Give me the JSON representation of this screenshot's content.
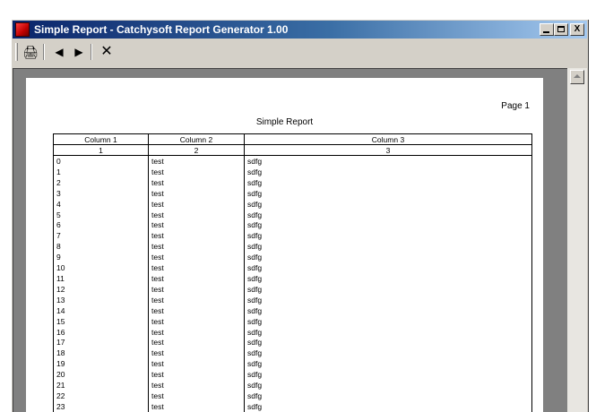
{
  "window": {
    "title": "Simple Report - Catchysoft Report Generator 1.00",
    "minimize_glyph": "_",
    "maximize_glyph": "□",
    "close_glyph": "X"
  },
  "toolbar": {
    "print_glyph": "🖨",
    "prev_glyph": "◀",
    "next_glyph": "▶",
    "close_glyph": "✕"
  },
  "report": {
    "page_label": "Page 1",
    "title": "Simple Report",
    "headers": [
      "Column 1",
      "Column 2",
      "Column 3"
    ],
    "subheaders": [
      "1",
      "2",
      "3"
    ],
    "rows": [
      [
        "0",
        "test",
        "sdfg"
      ],
      [
        "1",
        "test",
        "sdfg"
      ],
      [
        "2",
        "test",
        "sdfg"
      ],
      [
        "3",
        "test",
        "sdfg"
      ],
      [
        "4",
        "test",
        "sdfg"
      ],
      [
        "5",
        "test",
        "sdfg"
      ],
      [
        "6",
        "test",
        "sdfg"
      ],
      [
        "7",
        "test",
        "sdfg"
      ],
      [
        "8",
        "test",
        "sdfg"
      ],
      [
        "9",
        "test",
        "sdfg"
      ],
      [
        "10",
        "test",
        "sdfg"
      ],
      [
        "11",
        "test",
        "sdfg"
      ],
      [
        "12",
        "test",
        "sdfg"
      ],
      [
        "13",
        "test",
        "sdfg"
      ],
      [
        "14",
        "test",
        "sdfg"
      ],
      [
        "15",
        "test",
        "sdfg"
      ],
      [
        "16",
        "test",
        "sdfg"
      ],
      [
        "17",
        "test",
        "sdfg"
      ],
      [
        "18",
        "test",
        "sdfg"
      ],
      [
        "19",
        "test",
        "sdfg"
      ],
      [
        "20",
        "test",
        "sdfg"
      ],
      [
        "21",
        "test",
        "sdfg"
      ],
      [
        "22",
        "test",
        "sdfg"
      ],
      [
        "23",
        "test",
        "sdfg"
      ]
    ]
  }
}
